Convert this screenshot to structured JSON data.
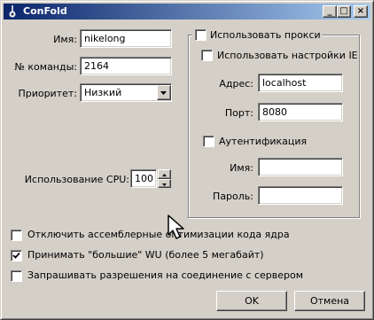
{
  "window": {
    "title": "ConFold"
  },
  "titlebar_buttons": {
    "minimize": "_",
    "maximize": "□",
    "close": "×"
  },
  "fields": {
    "name_label": "Имя:",
    "name_value": "nikelong",
    "team_label": "№ команды:",
    "team_value": "2164",
    "priority_label": "Приоритет:",
    "priority_value": "Низкий",
    "cpu_label": "Использование CPU:",
    "cpu_value": "100"
  },
  "proxy": {
    "use_proxy_label": "Использовать прокси",
    "use_proxy_checked": false,
    "use_ie_label": "Использовать настройки IE",
    "use_ie_checked": false,
    "address_label": "Адрес:",
    "address_value": "localhost",
    "port_label": "Порт:",
    "port_value": "8080",
    "auth_label": "Аутентификация",
    "auth_checked": false,
    "user_label": "Имя:",
    "user_value": "",
    "password_label": "Пароль:",
    "password_value": ""
  },
  "options": {
    "disable_asm_label": "Отключить ассемблерные оптимизации кода ядра",
    "disable_asm_checked": false,
    "big_wu_label": "Принимать \"большие\" WU (более 5 мегабайт)",
    "big_wu_checked": true,
    "ask_connect_label": "Запрашивать разрешения на соединение с сервером",
    "ask_connect_checked": false
  },
  "buttons": {
    "ok": "OK",
    "cancel": "Отмена"
  },
  "colors": {
    "face": "#d4d0c8",
    "title_start": "#0a246a",
    "title_end": "#a6caf0"
  }
}
